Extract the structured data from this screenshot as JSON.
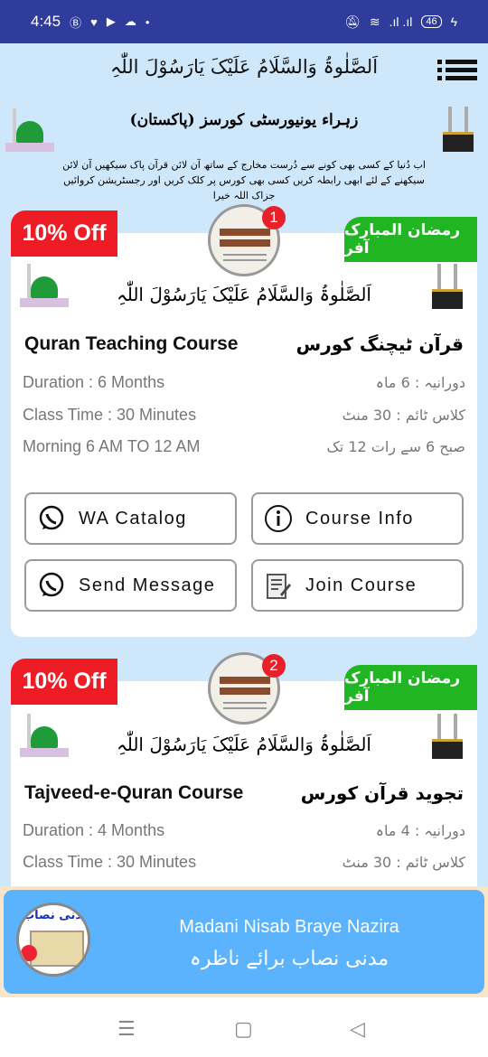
{
  "status_bar": {
    "time": "4:45",
    "battery": "46"
  },
  "header": {
    "calligraphy": "اَلصَّلٰوۃُ وَالسَّلَامُ عَلَیْکَ یَارَسُوْلَ اللّٰہِ",
    "title": "زہراء یونیورسٹی کورسز (پاکستان)",
    "description": "اب دُنیا کے کسی بھی کونے سے دُرست مخارج کے ساتھ آن لائن قرآن پاک سیکھیں آن لائن سیکھنے کے لئے ابھی رابطہ کریں کسی بھی کورس پر کلک کریں اور رجسٹریشن کروائیں جزاک اللہ خیرا"
  },
  "courses": [
    {
      "discount": "10% Off",
      "offer": "رمضان المبارک آفر",
      "number": "1",
      "calligraphy": "اَلصَّلٰوۃُ وَالسَّلَامُ عَلَیْکَ یَارَسُوْلَ اللّٰہِ",
      "title": "Quran Teaching Course",
      "title_urdu": "قرآن ٹیچنگ کورس",
      "duration": "Duration : 6 Months",
      "duration_urdu": "دورانیہ : 6 ماہ",
      "class_time": "Class Time : 30 Minutes",
      "class_time_urdu": "کلاس ٹائم : 30 منٹ",
      "timing": "Morning 6 AM TO 12 AM",
      "timing_urdu": "صبح 6 سے رات 12 تک",
      "buttons": {
        "wa_catalog": "WA Catalog",
        "course_info": "Course Info",
        "send_message": "Send Message",
        "join_course": "Join Course"
      }
    },
    {
      "discount": "10% Off",
      "offer": "رمضان المبارک آفر",
      "number": "2",
      "calligraphy": "اَلصَّلٰوۃُ وَالسَّلَامُ عَلَیْکَ یَارَسُوْلَ اللّٰہِ",
      "title": "Tajveed-e-Quran Course",
      "title_urdu": "تجوید قرآن کورس",
      "duration": "Duration : 4 Months",
      "duration_urdu": "دورانیہ : 4 ماہ",
      "class_time": "Class Time : 30 Minutes",
      "class_time_urdu": "کلاس ٹائم : 30 منٹ"
    }
  ],
  "banner": {
    "title": "Madani Nisab Braye Nazira",
    "title_urdu": "مدنی نصاب برائے ناظرہ",
    "thumb_text": "مدنی نصاب"
  },
  "colors": {
    "status_bar": "#2f3c9c",
    "background": "#cfe7fa",
    "discount": "#ee1c25",
    "offer": "#22b523",
    "banner": "#5ab3fc"
  }
}
